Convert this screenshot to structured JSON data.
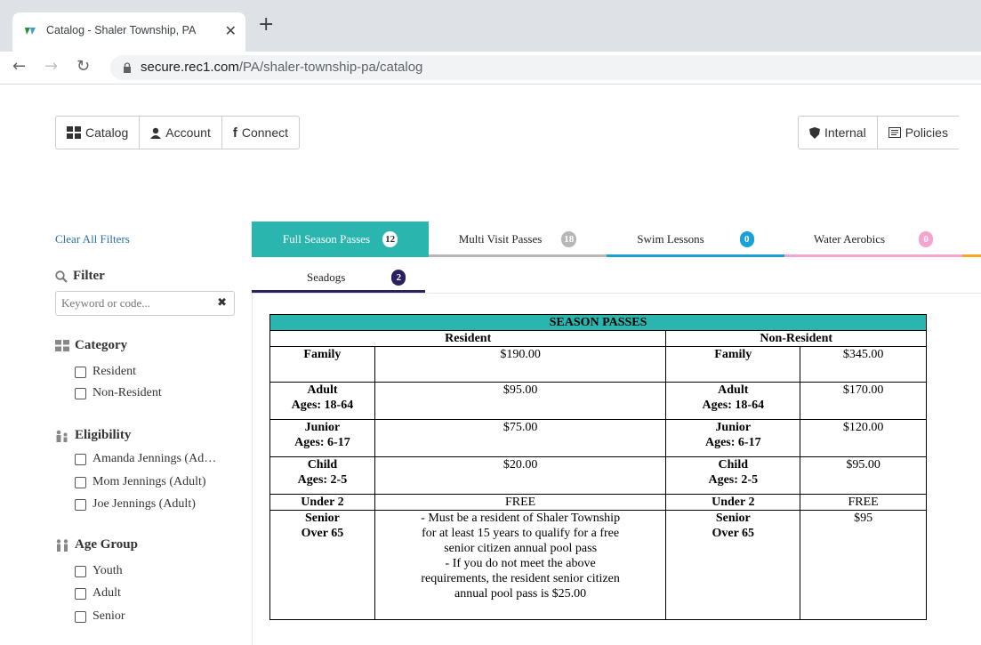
{
  "browser": {
    "tab_title": "Catalog - Shaler Township, PA",
    "url_host": "secure.rec1.com",
    "url_path": "/PA/shaler-township-pa/catalog"
  },
  "nav": {
    "catalog": "Catalog",
    "account": "Account",
    "connect": "Connect",
    "internal": "Internal",
    "policies": "Policies"
  },
  "sidebar": {
    "clear_filters": "Clear All Filters",
    "filter_heading": "Filter",
    "search_placeholder": "Keyword or code...",
    "category_heading": "Category",
    "category_items": [
      "Resident",
      "Non-Resident"
    ],
    "eligibility_heading": "Eligibility",
    "eligibility_items": [
      "Amanda Jennings (Ad…",
      "Mom Jennings (Adult)",
      "Joe Jennings (Adult)"
    ],
    "age_heading": "Age Group",
    "age_items": [
      "Youth",
      "Adult",
      "Senior"
    ]
  },
  "tabs": [
    {
      "label": "Full Season Passes",
      "count": "12",
      "color": "#2ab5ae"
    },
    {
      "label": "Multi Visit Passes",
      "count": "18",
      "color": "#b7b7b7"
    },
    {
      "label": "Swim Lessons",
      "count": "0",
      "color": "#1ba1d6"
    },
    {
      "label": "Water Aerobics",
      "count": "0",
      "color": "#f5a3cf"
    }
  ],
  "subtab": {
    "label": "Seadogs",
    "count": "2",
    "color": "#2a215e"
  },
  "table": {
    "title": "SEASON PASSES",
    "resident": "Resident",
    "non_resident": "Non-Resident",
    "rows": [
      {
        "r_label": [
          "Family"
        ],
        "r_price": [
          "$190.00"
        ],
        "n_label": [
          "Family"
        ],
        "n_price": [
          "$345.00"
        ]
      },
      {
        "r_label": [
          "Adult",
          "Ages: 18-64"
        ],
        "r_price": [
          "$95.00"
        ],
        "n_label": [
          "Adult",
          "Ages: 18-64"
        ],
        "n_price": [
          "$170.00"
        ]
      },
      {
        "r_label": [
          "Junior",
          "Ages: 6-17"
        ],
        "r_price": [
          "$75.00"
        ],
        "n_label": [
          "Junior",
          "Ages: 6-17"
        ],
        "n_price": [
          "$120.00"
        ]
      },
      {
        "r_label": [
          "Child",
          "Ages: 2-5"
        ],
        "r_price": [
          "$20.00"
        ],
        "n_label": [
          "Child",
          "Ages: 2-5"
        ],
        "n_price": [
          "$95.00"
        ]
      },
      {
        "r_label": [
          "Under 2"
        ],
        "r_price": [
          "FREE"
        ],
        "n_label": [
          "Under 2"
        ],
        "n_price": [
          "FREE"
        ]
      },
      {
        "r_label": [
          "Senior",
          "Over 65"
        ],
        "r_price": [
          "- Must be a resident of Shaler Township",
          "for at least 15 years to qualify for a free",
          "senior citizen annual pool pass",
          "- If you do not meet the above",
          "requirements, the resident senior citizen",
          "annual pool pass is $25.00"
        ],
        "n_label": [
          "Senior",
          "Over 65"
        ],
        "n_price": [
          "$95"
        ]
      }
    ]
  }
}
